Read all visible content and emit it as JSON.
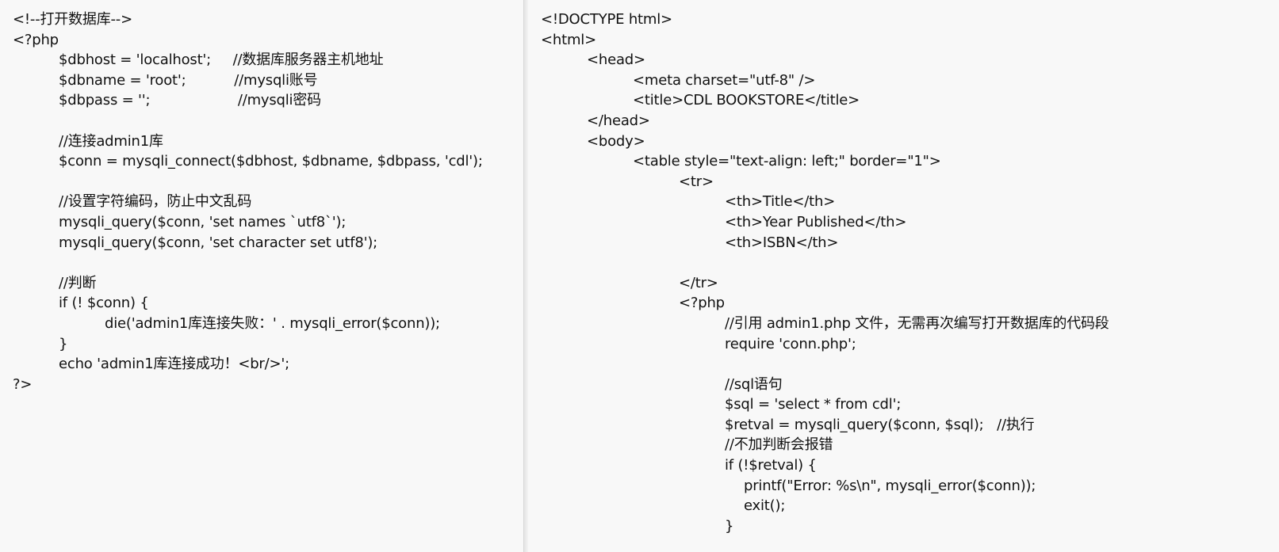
{
  "left_pane": {
    "lines": [
      {
        "text": "<!--打开数据库-->",
        "indent": 0
      },
      {
        "text": "<?php",
        "indent": 0
      },
      {
        "text": "$dbhost = 'localhost';     //数据库服务器主机地址",
        "indent": 1
      },
      {
        "text": "$dbname = 'root';           //mysqli账号",
        "indent": 1
      },
      {
        "text": "$dbpass = '';                    //mysqli密码",
        "indent": 1
      },
      {
        "text": "",
        "indent": 0
      },
      {
        "text": "//连接admin1库",
        "indent": 1
      },
      {
        "text": "$conn = mysqli_connect($dbhost, $dbname, $dbpass, 'cdl');",
        "indent": 1
      },
      {
        "text": "",
        "indent": 0
      },
      {
        "text": "//设置字符编码，防止中文乱码",
        "indent": 1
      },
      {
        "text": "mysqli_query($conn, 'set names `utf8`');",
        "indent": 1
      },
      {
        "text": "mysqli_query($conn, 'set character set utf8');",
        "indent": 1
      },
      {
        "text": "",
        "indent": 0
      },
      {
        "text": "//判断",
        "indent": 1
      },
      {
        "text": "if (! $conn) {",
        "indent": 1
      },
      {
        "text": "die('admin1库连接失败：' . mysqli_error($conn));",
        "indent": 2
      },
      {
        "text": "}",
        "indent": 1
      },
      {
        "text": "echo 'admin1库连接成功！<br/>';",
        "indent": 1
      },
      {
        "text": "?>",
        "indent": 0
      }
    ]
  },
  "right_pane": {
    "lines": [
      {
        "text": "<!DOCTYPE html>",
        "indent": 0
      },
      {
        "text": "<html>",
        "indent": 0
      },
      {
        "text": "<head>",
        "indent": 1
      },
      {
        "text": "<meta charset=\"utf-8\" />",
        "indent": 2
      },
      {
        "text": "<title>CDL BOOKSTORE</title>",
        "indent": 2
      },
      {
        "text": "</head>",
        "indent": 1
      },
      {
        "text": "<body>",
        "indent": 1
      },
      {
        "text": "<table style=\"text-align: left;\" border=\"1\">",
        "indent": 2
      },
      {
        "text": "<tr>",
        "indent": 3
      },
      {
        "text": "<th>Title</th>",
        "indent": 4
      },
      {
        "text": "<th>Year Published</th>",
        "indent": 4
      },
      {
        "text": "<th>ISBN</th>",
        "indent": 4
      },
      {
        "text": "",
        "indent": 0
      },
      {
        "text": "</tr>",
        "indent": 3
      },
      {
        "text": "<?php",
        "indent": 3
      },
      {
        "text": "//引用 admin1.php 文件，无需再次编写打开数据库的代码段",
        "indent": 4
      },
      {
        "text": "require 'conn.php';",
        "indent": 4
      },
      {
        "text": "",
        "indent": 0
      },
      {
        "text": "//sql语句",
        "indent": 4
      },
      {
        "text": "$sql = 'select * from cdl';",
        "indent": 4
      },
      {
        "text": "$retval = mysqli_query($conn, $sql);   //执行",
        "indent": 4
      },
      {
        "text": "//不加判断会报错",
        "indent": 4
      },
      {
        "text": "if (!$retval) {",
        "indent": 4
      },
      {
        "text": "printf(\"Error: %s\\n\", mysqli_error($conn));",
        "indent": 5
      },
      {
        "text": "exit();",
        "indent": 5
      },
      {
        "text": "}",
        "indent": 4
      }
    ]
  }
}
